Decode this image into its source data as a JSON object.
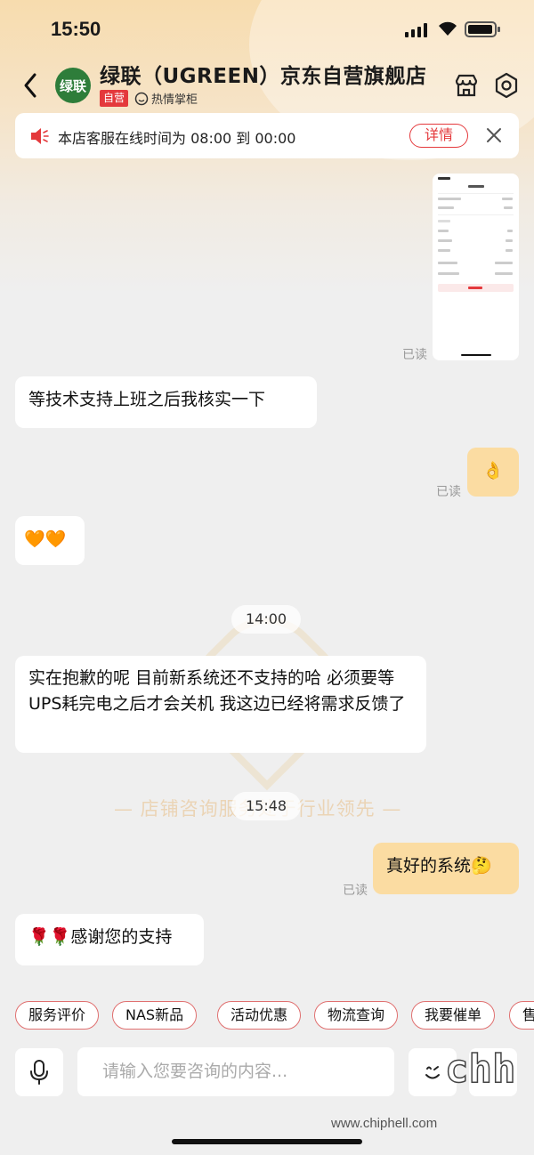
{
  "status_bar": {
    "time": "15:50"
  },
  "header": {
    "logo_text": "绿联",
    "shop_name": "绿联（UGREEN）京东自营旗舰店",
    "self_badge": "自营",
    "hot_label": "热情掌柜"
  },
  "notice": {
    "text": "本店客服在线时间为 08:00 到 00:00",
    "detail_label": "详情"
  },
  "messages": [
    {
      "side": "me",
      "type": "image",
      "read": "已读"
    },
    {
      "side": "other",
      "type": "text",
      "text": "等技术支持上班之后我核实一下"
    },
    {
      "side": "me",
      "type": "text",
      "text": "👌",
      "read": "已读"
    },
    {
      "side": "other",
      "type": "text",
      "text": "🧡🧡"
    },
    {
      "type": "time",
      "text": "14:00"
    },
    {
      "side": "other",
      "type": "text",
      "text": "实在抱歉的呢 目前新系统还不支持的哈 必须要等UPS耗完电之后才会关机  我这边已经将需求反馈了"
    },
    {
      "type": "time",
      "text": "15:48"
    },
    {
      "side": "me",
      "type": "text",
      "text": "真好的系统🤔",
      "read": "已读"
    },
    {
      "side": "other",
      "type": "text",
      "text": "🌹🌹感谢您的支持"
    }
  ],
  "background_watermark": "— 店铺咨询服务处于行业领先 —",
  "quick_replies": [
    "服务评价",
    "NAS新品",
    "活动优惠",
    "物流查询",
    "我要催单",
    "售"
  ],
  "input": {
    "placeholder": "请输入您要咨询的内容..."
  },
  "site_watermark": "www.chiphell.com",
  "colors": {
    "accent": "#e4393c",
    "my_bubble": "#fbdca2",
    "logo_green": "#2e7d3a"
  }
}
